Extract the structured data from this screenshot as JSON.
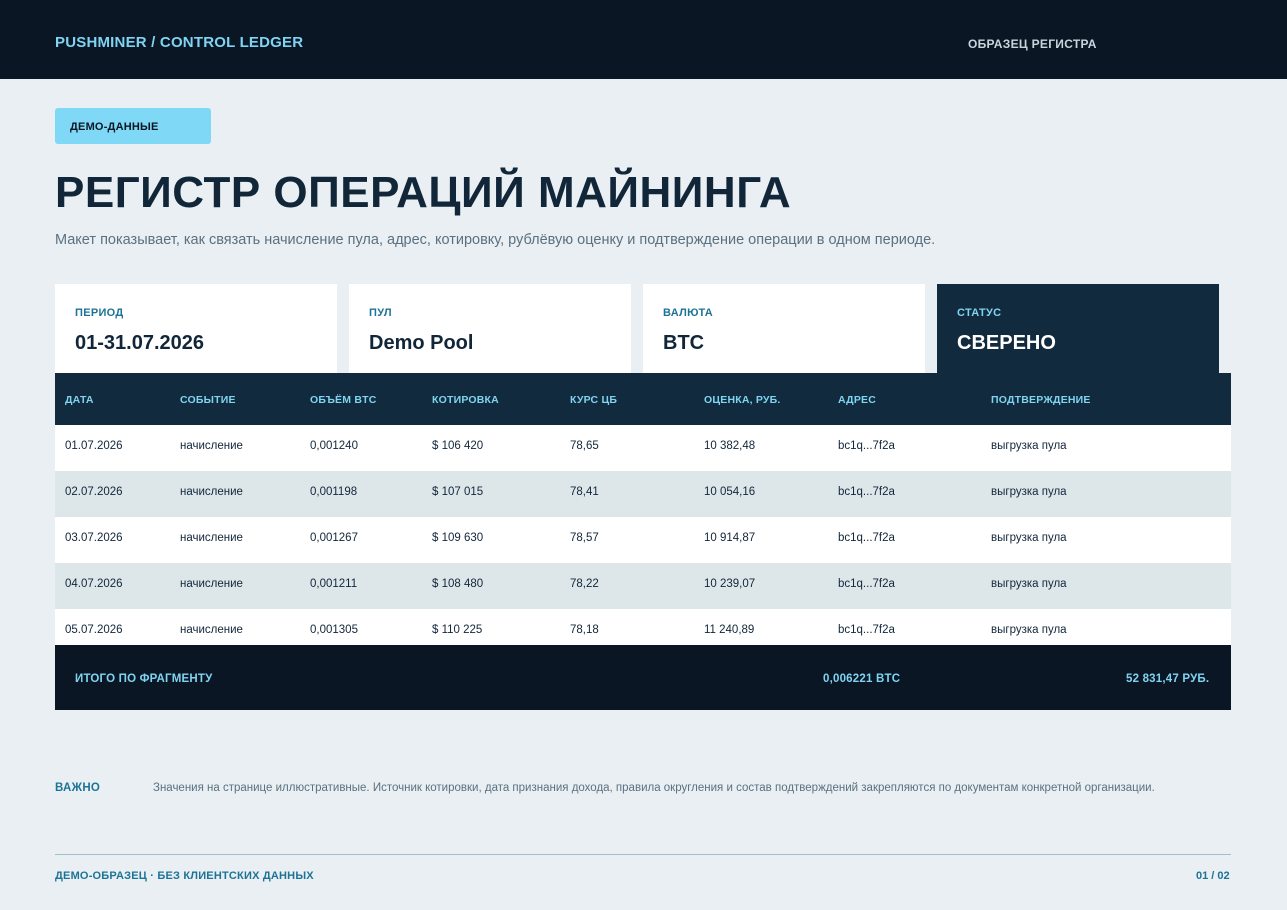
{
  "header": {
    "brand": "PUSHMINER / CONTROL LEDGER",
    "right_label": "ОБРАЗЕЦ РЕГИСТРА"
  },
  "badge": "ДЕМО-ДАННЫЕ",
  "title": "РЕГИСТР ОПЕРАЦИЙ МАЙНИНГА",
  "subtitle": "Макет показывает, как связать начисление пула, адрес, котировку, рублёвую оценку и подтверждение операции в одном периоде.",
  "cards": [
    {
      "label": "ПЕРИОД",
      "value": "01-31.07.2026"
    },
    {
      "label": "ПУЛ",
      "value": "Demo Pool"
    },
    {
      "label": "ВАЛЮТА",
      "value": "BTC"
    },
    {
      "label": "СТАТУС",
      "value": "СВЕРЕНО"
    }
  ],
  "table": {
    "headers": [
      "ДАТА",
      "СОБЫТИЕ",
      "ОБЪЁМ BTC",
      "КОТИРОВКА",
      "КУРС ЦБ",
      "ОЦЕНКА, РУБ.",
      "АДРЕС",
      "ПОДТВЕРЖДЕНИЕ"
    ],
    "rows": [
      [
        "01.07.2026",
        "начисление",
        "0,001240",
        "$ 106 420",
        "78,65",
        "10 382,48",
        "bc1q...7f2a",
        "выгрузка пула"
      ],
      [
        "02.07.2026",
        "начисление",
        "0,001198",
        "$ 107 015",
        "78,41",
        "10 054,16",
        "bc1q...7f2a",
        "выгрузка пула"
      ],
      [
        "03.07.2026",
        "начисление",
        "0,001267",
        "$ 109 630",
        "78,57",
        "10 914,87",
        "bc1q...7f2a",
        "выгрузка пула"
      ],
      [
        "04.07.2026",
        "начисление",
        "0,001211",
        "$ 108 480",
        "78,22",
        "10 239,07",
        "bc1q...7f2a",
        "выгрузка пула"
      ],
      [
        "05.07.2026",
        "начисление",
        "0,001305",
        "$ 110 225",
        "78,18",
        "11 240,89",
        "bc1q...7f2a",
        "выгрузка пула"
      ]
    ],
    "footer": {
      "label": "ИТОГО ПО ФРАГМЕНТУ",
      "btc_total": "0,006221 BTC",
      "rub_total": "52 831,47 РУБ."
    }
  },
  "note": {
    "label": "ВАЖНО",
    "text": "Значения на странице иллюстративные. Источник котировки, дата признания дохода, правила округления и состав подтверждений закрепляются по документам конкретной организации."
  },
  "footer": {
    "left": "ДЕМО-ОБРАЗЕЦ · БЕЗ КЛИЕНТСКИХ ДАННЫХ",
    "page": "01 / 02"
  }
}
